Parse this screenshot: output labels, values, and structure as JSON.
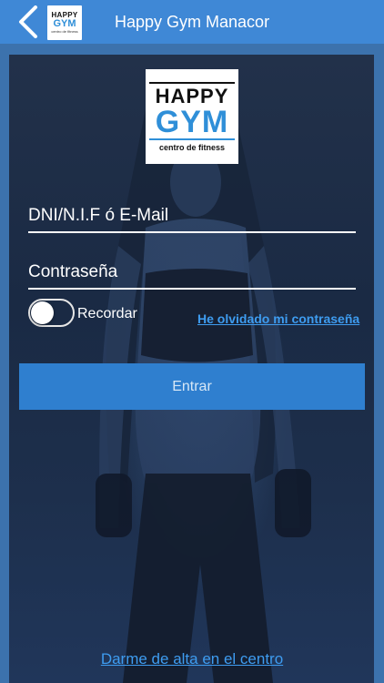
{
  "header": {
    "title": "Happy Gym Manacor",
    "logo_line1": "HAPPY",
    "logo_line2": "GYM",
    "logo_line3": "centro de fitness"
  },
  "logo": {
    "line1": "HAPPY",
    "line2": "GYM",
    "line3": "centro de fitness"
  },
  "form": {
    "user_placeholder": "DNI/N.I.F ó E-Mail",
    "password_placeholder": "Contraseña",
    "remember_label": "Recordar",
    "remember_on": false,
    "forgot_link": "He olvidado mi contraseña",
    "submit_label": "Entrar"
  },
  "footer": {
    "signup_link": "Darme de alta en el centro"
  },
  "colors": {
    "header_bg": "#3f88d6",
    "button_bg": "#2f7fcf",
    "link": "#3e9cf0",
    "logo_blue": "#2f8fd8"
  }
}
